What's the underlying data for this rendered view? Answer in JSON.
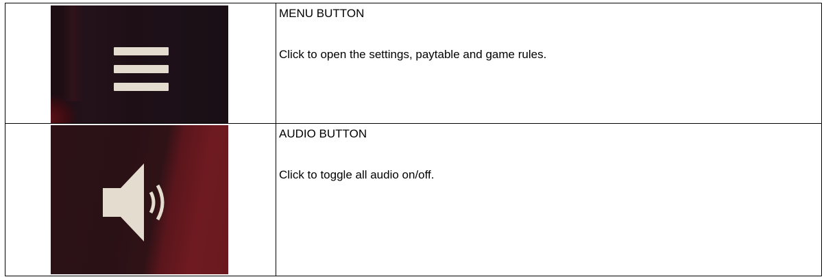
{
  "rows": [
    {
      "icon": "menu-icon",
      "title": "MENU BUTTON",
      "description": "Click to open the settings, paytable and game rules."
    },
    {
      "icon": "speaker-icon",
      "title": "AUDIO BUTTON",
      "description": "Click to toggle all audio on/off."
    }
  ],
  "colors": {
    "icon_light": "#e3dccf",
    "background_dark": "#1c0d12",
    "accent_red": "#6e1a20",
    "border": "#000000"
  }
}
